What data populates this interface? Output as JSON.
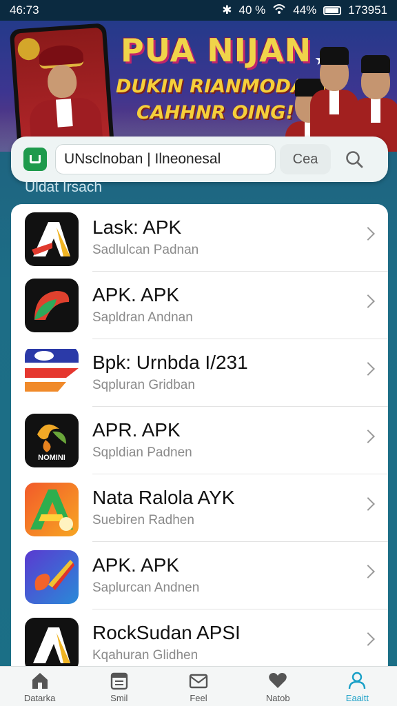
{
  "status_bar": {
    "time": "46:73",
    "signal": "40 %",
    "battery": "44%",
    "clock": "173951"
  },
  "banner": {
    "title": "PUA NIJAN",
    "line2": "DUKIN RIANMODAON",
    "line3": "CAHHNR OING!"
  },
  "search": {
    "value": "UNsclnoban | Ilneonesal",
    "button_label": "Cea"
  },
  "section_label": "Uldat Irsach",
  "apps": [
    {
      "title": "Lask: APK",
      "subtitle": "Sadlulcan Padnan",
      "icon": "a-logo-icon"
    },
    {
      "title": "APK. APK",
      "subtitle": "Sapldran Andnan",
      "icon": "leaf-logo-icon"
    },
    {
      "title": "Bpk: Urnbda I/231",
      "subtitle": "Sqpluran Gridban",
      "icon": "stripes-logo-icon"
    },
    {
      "title": "APR. APK",
      "subtitle": "Sqpldian Padnen",
      "icon": "nomini-logo-icon",
      "icon_text": "NOMINI"
    },
    {
      "title": "Nata Ralola AYK",
      "subtitle": "Suebiren Radhen",
      "icon": "rainbow-a-logo-icon"
    },
    {
      "title": "APK. APK",
      "subtitle": "Saplurcan Andnen",
      "icon": "brush-logo-icon"
    },
    {
      "title": "RockSudan APSI",
      "subtitle": "Kqahuran Glidhen",
      "icon": "rock-logo-icon"
    }
  ],
  "tabs": [
    {
      "label": "Datarka",
      "icon": "home-icon"
    },
    {
      "label": "Smil",
      "icon": "calendar-icon"
    },
    {
      "label": "Feel",
      "icon": "mail-icon"
    },
    {
      "label": "Natob",
      "icon": "heart-icon"
    },
    {
      "label": "Eaaitt",
      "icon": "user-icon",
      "active": true
    }
  ],
  "colors": {
    "accent": "#1aa0c7",
    "brand_green": "#1e9a4c",
    "header_bg": "#0b2a40"
  }
}
